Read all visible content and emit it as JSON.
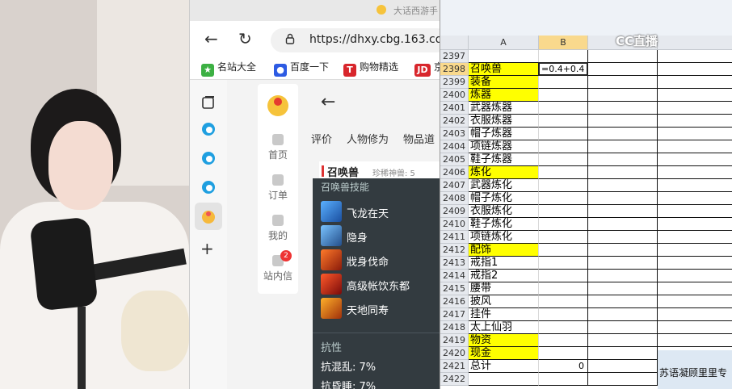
{
  "browser": {
    "tab_title": "大话西游手",
    "url": "https://dhxy.cbg.163.com",
    "bookmarks": [
      "名站大全",
      "百度一下",
      "购物精选",
      "京"
    ],
    "app_nav": [
      {
        "label": "首页"
      },
      {
        "label": "订单"
      },
      {
        "label": "我的"
      },
      {
        "label": "站内信",
        "badge": "2"
      }
    ],
    "tabs": [
      "评价",
      "人物修为",
      "物品道"
    ],
    "item_title": "召唤兽",
    "item_subtitle": "珍稀神兽: 5",
    "popup": {
      "header": "召唤兽技能",
      "skills": [
        "飞龙在天",
        "隐身",
        "戕身伐命",
        "高级帐饮东都",
        "天地同寿"
      ],
      "resist_header": "抗性",
      "resists": [
        "抗混乱: 7%",
        "抗昏睡: 7%"
      ]
    }
  },
  "excel": {
    "columns": [
      "A",
      "B"
    ],
    "active_row": "2398",
    "active_cell_value": "=0.4+0.4",
    "rows": [
      {
        "num": "2397",
        "a": "",
        "yellow": false
      },
      {
        "num": "2398",
        "a": "召唤兽",
        "yellow": true
      },
      {
        "num": "2399",
        "a": "装备",
        "yellow": true
      },
      {
        "num": "2400",
        "a": "炼器",
        "yellow": true
      },
      {
        "num": "2401",
        "a": "武器炼器",
        "yellow": false
      },
      {
        "num": "2402",
        "a": "衣服炼器",
        "yellow": false
      },
      {
        "num": "2403",
        "a": "帽子炼器",
        "yellow": false
      },
      {
        "num": "2404",
        "a": "项链炼器",
        "yellow": false
      },
      {
        "num": "2405",
        "a": "鞋子炼器",
        "yellow": false
      },
      {
        "num": "2406",
        "a": "炼化",
        "yellow": true
      },
      {
        "num": "2407",
        "a": "武器炼化",
        "yellow": false
      },
      {
        "num": "2408",
        "a": "帽子炼化",
        "yellow": false
      },
      {
        "num": "2409",
        "a": "衣服炼化",
        "yellow": false
      },
      {
        "num": "2410",
        "a": "鞋子炼化",
        "yellow": false
      },
      {
        "num": "2411",
        "a": "项链炼化",
        "yellow": false
      },
      {
        "num": "2412",
        "a": "配饰",
        "yellow": true
      },
      {
        "num": "2413",
        "a": "戒指1",
        "yellow": false
      },
      {
        "num": "2414",
        "a": "戒指2",
        "yellow": false
      },
      {
        "num": "2415",
        "a": "腰带",
        "yellow": false
      },
      {
        "num": "2416",
        "a": "披风",
        "yellow": false
      },
      {
        "num": "2417",
        "a": "挂件",
        "yellow": false
      },
      {
        "num": "2418",
        "a": "太上仙羽",
        "yellow": false
      },
      {
        "num": "2419",
        "a": "物资",
        "yellow": true
      },
      {
        "num": "2420",
        "a": "现金",
        "yellow": true
      },
      {
        "num": "2421",
        "a": "总计",
        "yellow": false,
        "b": "0"
      },
      {
        "num": "2422",
        "a": "",
        "yellow": false
      }
    ],
    "note": "苏语凝顾里里专",
    "watermark": "CC直播"
  }
}
